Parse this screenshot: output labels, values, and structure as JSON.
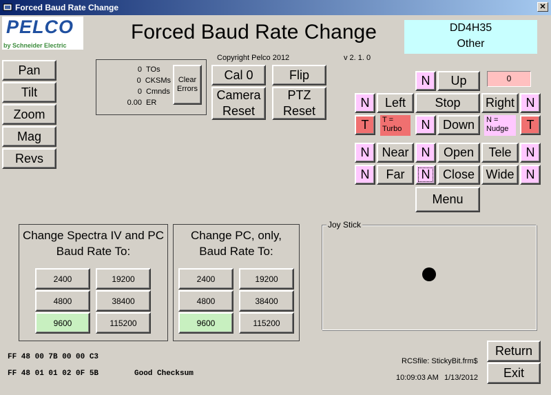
{
  "window": {
    "title": "Forced Baud Rate Change",
    "close_glyph": "✕"
  },
  "logo": {
    "brand": "PELCO",
    "sub": "by Schneider Electric"
  },
  "header": {
    "title": "Forced Baud Rate Change",
    "device_id": "DD4H35",
    "device_type": "Other",
    "copyright": "Copyright Pelco 2012",
    "version": "v 2. 1. 0"
  },
  "left_buttons": [
    "Pan",
    "Tilt",
    "Zoom",
    "Mag",
    "Revs"
  ],
  "counters": {
    "rows": [
      {
        "value": "0",
        "label": "TOs"
      },
      {
        "value": "0",
        "label": "CKSMs"
      },
      {
        "value": "0",
        "label": "Cmnds"
      },
      {
        "value": "0.00",
        "label": "ER"
      }
    ],
    "clear_label": "Clear Errors"
  },
  "commands": {
    "cal": "Cal 0",
    "flip": "Flip",
    "camera_reset": "Camera Reset",
    "ptz_reset": "PTZ Reset"
  },
  "ptz": {
    "up": "Up",
    "down": "Down",
    "left": "Left",
    "right": "Right",
    "stop": "Stop",
    "near": "Near",
    "far": "Far",
    "open": "Open",
    "close": "Close",
    "tele": "Tele",
    "wide": "Wide",
    "menu": "Menu",
    "n": "N",
    "t": "T",
    "speed_value": "0",
    "turbo_note": "T = Turbo",
    "nudge_note": "N = Nudge"
  },
  "baud_spectra": {
    "title": "Change Spectra IV and PC Baud Rate To:",
    "rates": [
      "2400",
      "19200",
      "4800",
      "38400",
      "9600",
      "115200"
    ],
    "selected": "9600"
  },
  "baud_pc": {
    "title": "Change PC, only, Baud Rate To:",
    "rates": [
      "2400",
      "19200",
      "4800",
      "38400",
      "9600",
      "115200"
    ],
    "selected": "9600"
  },
  "joystick": {
    "label": "Joy Stick"
  },
  "hex": {
    "line1": "FF 48 00 7B 00 00 C3",
    "line2": "FF 48 01 01 02 0F 5B",
    "status": "Good Checksum"
  },
  "footer": {
    "rcs_file": "RCSfile: StickyBit.frm$",
    "time": "10:09:03 AM",
    "date": "1/13/2012",
    "return": "Return",
    "exit": "Exit"
  },
  "colors": {
    "n_button": "#ffc8ff",
    "t_button": "#f07070",
    "selected_rate": "#c8f0c0",
    "device_box": "#c8ffff",
    "speed_box": "#ffc0c0"
  }
}
